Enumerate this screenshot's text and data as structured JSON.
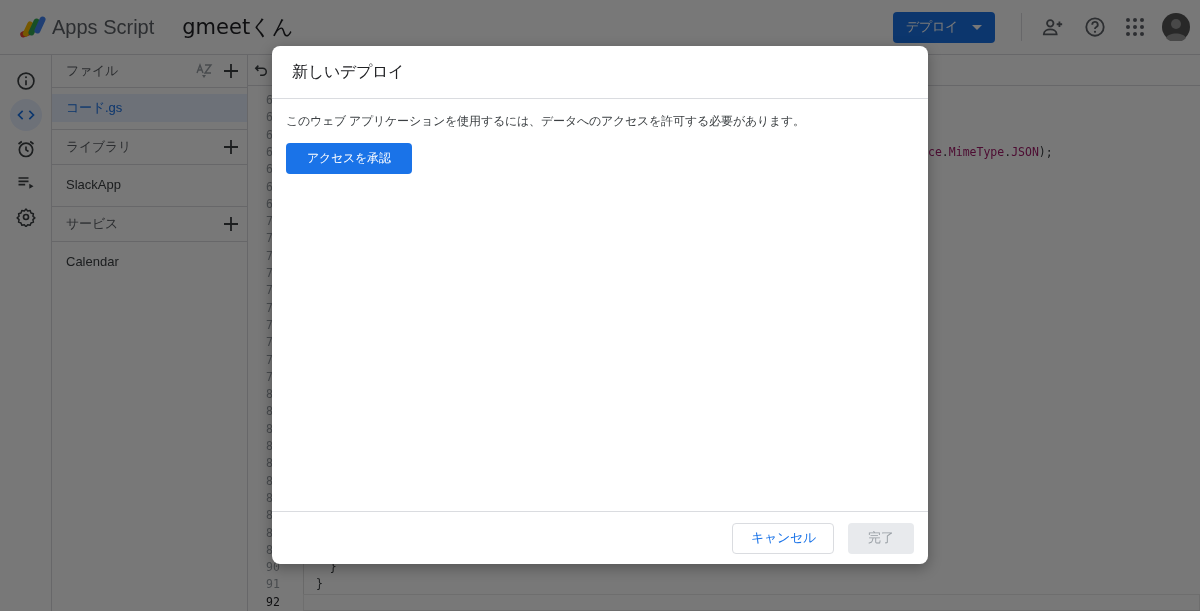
{
  "app": {
    "product": "Apps Script",
    "project_title": "gmeetくん"
  },
  "header": {
    "deploy_button": "デプロイ"
  },
  "rail": [
    {
      "kind": "info",
      "selected": false
    },
    {
      "kind": "code",
      "selected": true
    },
    {
      "kind": "triggers",
      "selected": false
    },
    {
      "kind": "executions",
      "selected": false
    },
    {
      "kind": "settings",
      "selected": false
    }
  ],
  "file_panel": {
    "sections": [
      {
        "title": "ファイル",
        "tools": [
          {
            "kind": "sort"
          },
          {
            "kind": "add"
          }
        ],
        "items": [
          {
            "label": "コード.gs",
            "selected": true
          }
        ]
      },
      {
        "title": "ライブラリ",
        "tools": [
          {
            "kind": "add"
          }
        ],
        "items": [
          {
            "label": "SlackApp",
            "selected": false
          }
        ]
      },
      {
        "title": "サービス",
        "tools": [
          {
            "kind": "add"
          }
        ],
        "items": [
          {
            "label": "Calendar",
            "selected": false
          }
        ]
      }
    ]
  },
  "editor": {
    "lines": [
      {
        "number": "6",
        "current": false
      },
      {
        "number": "6",
        "current": false
      },
      {
        "number": "6",
        "current": false
      },
      {
        "number": "6",
        "current": false,
        "tail": [
          {
            "text": "ce",
            "kind": "ident"
          },
          {
            "text": ".",
            "kind": "plain"
          },
          {
            "text": "MimeType",
            "kind": "ident"
          },
          {
            "text": ".",
            "kind": "plain"
          },
          {
            "text": "JSON",
            "kind": "ident"
          },
          {
            "text": ");",
            "kind": "plain"
          }
        ]
      },
      {
        "number": "6",
        "current": false
      },
      {
        "number": "6",
        "current": false
      },
      {
        "number": "6",
        "current": false
      },
      {
        "number": "7",
        "current": false
      },
      {
        "number": "7",
        "current": false
      },
      {
        "number": "7",
        "current": false
      },
      {
        "number": "7",
        "current": false
      },
      {
        "number": "7",
        "current": false
      },
      {
        "number": "7",
        "current": false
      },
      {
        "number": "7",
        "current": false
      },
      {
        "number": "7",
        "current": false
      },
      {
        "number": "7",
        "current": false
      },
      {
        "number": "7",
        "current": false
      },
      {
        "number": "8",
        "current": false
      },
      {
        "number": "8",
        "current": false
      },
      {
        "number": "8",
        "current": false
      },
      {
        "number": "8",
        "current": false
      },
      {
        "number": "8",
        "current": false
      },
      {
        "number": "8",
        "current": false
      },
      {
        "number": "8",
        "current": false
      },
      {
        "number": "8",
        "current": false
      },
      {
        "number": "8",
        "current": false
      },
      {
        "number": "8",
        "current": false
      },
      {
        "number": "90",
        "current": false,
        "code": "  }"
      },
      {
        "number": "91",
        "current": false,
        "code": "}"
      },
      {
        "number": "92",
        "current": true
      }
    ]
  },
  "dialog": {
    "title": "新しいデプロイ",
    "message": "このウェブ アプリケーションを使用するには、データへのアクセスを許可する必要があります。",
    "authorize_button": "アクセスを承認",
    "buttons": [
      {
        "label": "キャンセル",
        "kind": "secondary",
        "disabled": false
      },
      {
        "label": "完了",
        "kind": "primary",
        "disabled": true
      }
    ]
  }
}
